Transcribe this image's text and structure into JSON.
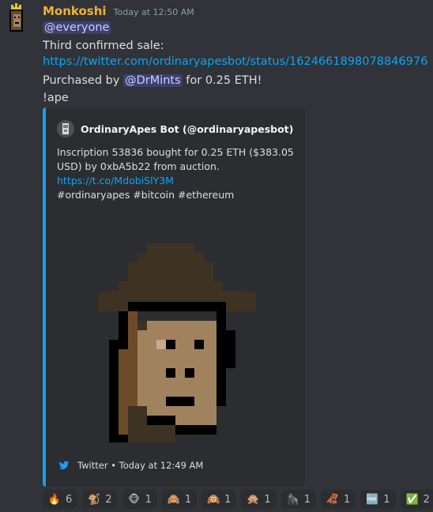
{
  "message": {
    "username": "Monkoshi",
    "timestamp": "Today at 12:50 AM",
    "mention_everyone": "@everyone",
    "line_sale": "Third confirmed sale:",
    "link": "https://twitter.com/ordinaryapesbot/status/1624661898078846976",
    "purchased_prefix": "Purchased by ",
    "mention_user": "@DrMints",
    "purchased_suffix": " for 0.25 ETH!",
    "command": "!ape"
  },
  "embed": {
    "accent_color": "#1d9bf0",
    "author": "OrdinaryApes Bot (@ordinaryapesbot)",
    "desc_line1": "Inscription 53836 bought for 0.25 ETH ($383.05",
    "desc_line2": "USD) by 0xbA5b22 from auction.",
    "desc_link": "https://t.co/MdobiSlY3M",
    "hashtags": "#ordinaryapes #bitcoin #ethereum",
    "footer": "Twitter • Today at 12:49 AM"
  },
  "reactions": [
    {
      "icon": "fire-icon",
      "glyph": "🔥",
      "count": "6"
    },
    {
      "icon": "monkey-icon",
      "glyph": "🐒",
      "count": "2"
    },
    {
      "icon": "monkey-face-icon",
      "glyph": "🐵",
      "count": "1"
    },
    {
      "icon": "see-no-evil-monkey-icon",
      "glyph": "🙈",
      "count": "1"
    },
    {
      "icon": "hear-no-evil-monkey-icon",
      "glyph": "🙉",
      "count": "1"
    },
    {
      "icon": "speak-no-evil-monkey-icon",
      "glyph": "🙊",
      "count": "1"
    },
    {
      "icon": "ape-custom-icon",
      "glyph": "🦍",
      "count": "1"
    },
    {
      "icon": "orangutan-icon",
      "glyph": "🦧",
      "count": "1"
    },
    {
      "icon": "free-icon",
      "glyph": "🆓",
      "count": "1"
    },
    {
      "icon": "check-mark-icon",
      "glyph": "✅",
      "count": "2"
    }
  ]
}
